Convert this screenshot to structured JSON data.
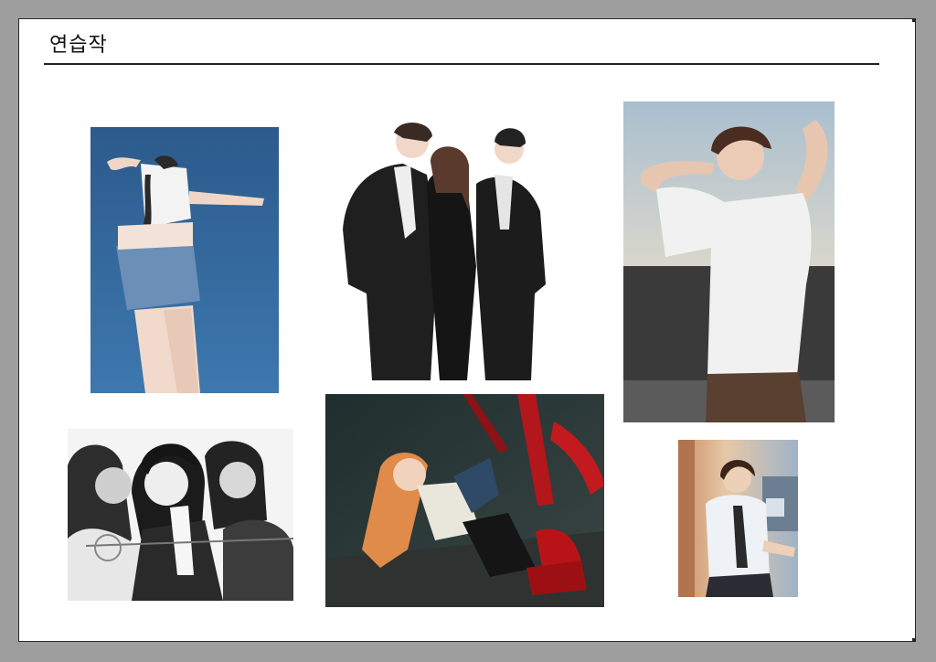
{
  "page": {
    "title": "연습작"
  },
  "artworks": [
    {
      "icon": "dancer-illustration-icon"
    },
    {
      "icon": "suits-trio-illustration-icon"
    },
    {
      "icon": "stretching-man-illustration-icon"
    },
    {
      "icon": "fencing-trio-illustration-icon"
    },
    {
      "icon": "chainsaw-girl-illustration-icon"
    },
    {
      "icon": "window-boy-illustration-icon"
    }
  ],
  "colors": {
    "background": "#9e9e9e",
    "page": "#ffffff",
    "rule": "#222222"
  }
}
